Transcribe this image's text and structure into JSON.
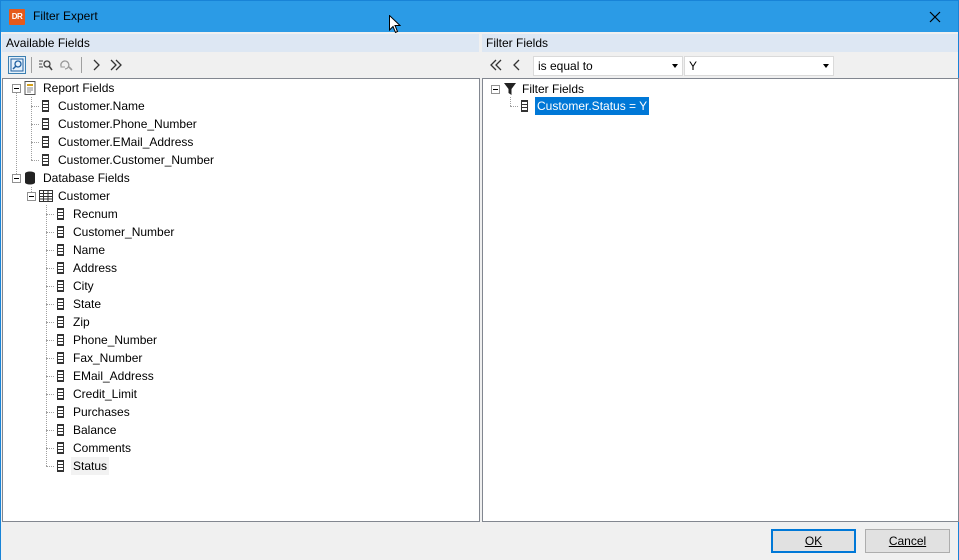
{
  "window": {
    "title": "Filter Expert",
    "app_icon_text": "DR"
  },
  "left_panel": {
    "header": "Available Fields",
    "tree": {
      "report_fields_label": "Report Fields",
      "report_fields": [
        "Customer.Name",
        "Customer.Phone_Number",
        "Customer.EMail_Address",
        "Customer.Customer_Number"
      ],
      "database_fields_label": "Database Fields",
      "table_label": "Customer",
      "table_fields": [
        "Recnum",
        "Customer_Number",
        "Name",
        "Address",
        "City",
        "State",
        "Zip",
        "Phone_Number",
        "Fax_Number",
        "EMail_Address",
        "Credit_Limit",
        "Purchases",
        "Balance",
        "Comments",
        "Status"
      ]
    }
  },
  "right_panel": {
    "header": "Filter Fields",
    "operator_value": "is equal to",
    "operand_value": "Y",
    "tree": {
      "root_label": "Filter Fields",
      "filters": [
        "Customer.Status = Y"
      ]
    }
  },
  "buttons": {
    "ok_label": "OK",
    "cancel_label": "Cancel"
  },
  "colors": {
    "titlebar": "#2b9be6",
    "selection": "#0078d7",
    "header": "#dde7f3",
    "app_icon": "#e55a1c"
  }
}
